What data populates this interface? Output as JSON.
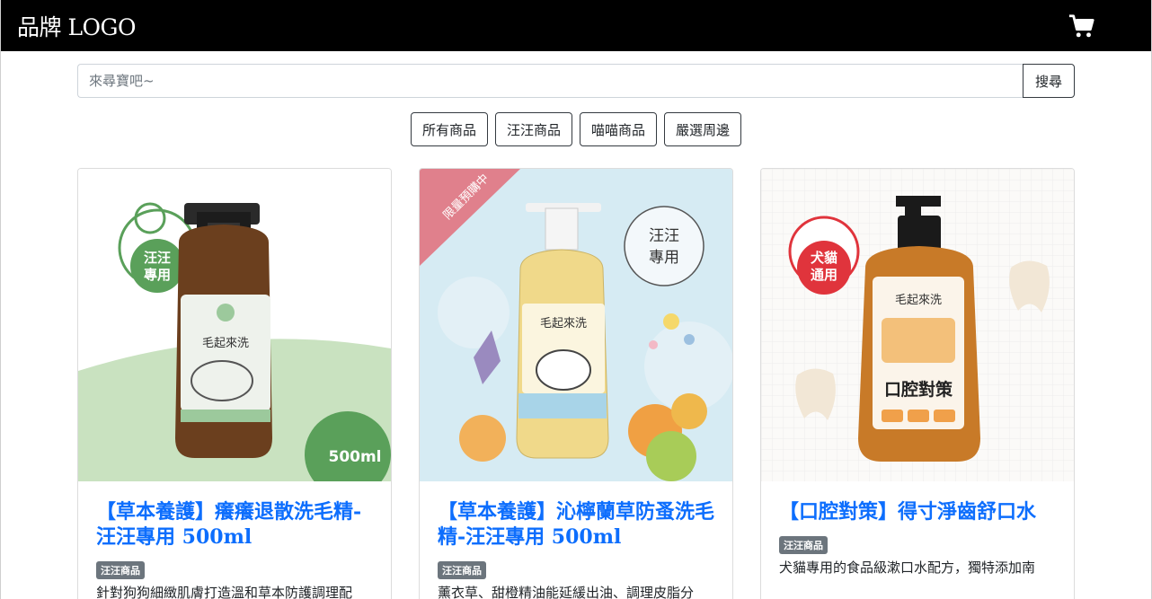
{
  "navbar": {
    "brand": "品牌 LOGO",
    "cart_icon": "shopping-cart-icon"
  },
  "search": {
    "placeholder": "來尋寶吧~",
    "button_label": "搜尋"
  },
  "categories": [
    "所有商品",
    "汪汪商品",
    "喵喵商品",
    "嚴選周邊"
  ],
  "products": [
    {
      "title": "【草本養護】癢癢退散洗毛精-汪汪專用 500ml",
      "badge": "汪汪商品",
      "description": "針對狗狗細緻肌膚打造溫和草本防護調理配",
      "image": {
        "stamp": "汪汪專用",
        "size": "500ml",
        "brand": "毛起來洗",
        "accent": "#6aaa6a"
      }
    },
    {
      "title": "【草本養護】沁檸蘭草防蚤洗毛精-汪汪專用 500ml",
      "badge": "汪汪商品",
      "description": "薰衣草、甜橙精油能延緩出油、調理皮脂分",
      "image": {
        "ribbon": "限量預購中",
        "stamp": "汪汪專用",
        "brand": "毛起來洗",
        "accent": "#e0808c"
      }
    },
    {
      "title": "【口腔對策】得寸淨齒舒口水",
      "badge": "汪汪商品",
      "description": "犬貓專用的食品級漱口水配方，獨特添加南",
      "image": {
        "stamp": "犬貓通用",
        "brand": "毛起來洗",
        "label": "口腔對策",
        "accent": "#e0343c"
      }
    }
  ]
}
